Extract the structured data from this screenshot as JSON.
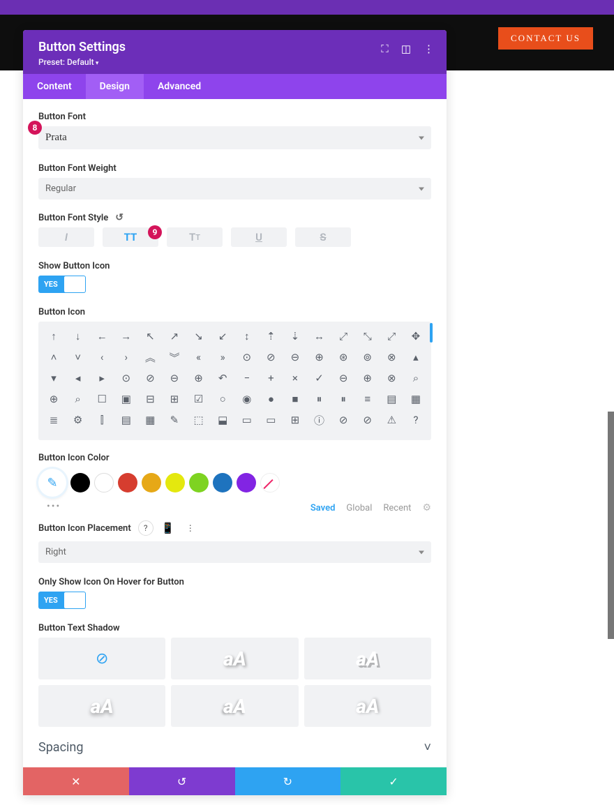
{
  "topbar": {
    "contact": "CONTACT US"
  },
  "panel": {
    "title": "Button Settings",
    "preset": "Preset: Default",
    "tabs": [
      "Content",
      "Design",
      "Advanced"
    ],
    "active_tab": 1
  },
  "badges": {
    "b8": "8",
    "b9": "9"
  },
  "sections": {
    "font": {
      "label": "Button Font",
      "value": "Prata"
    },
    "weight": {
      "label": "Button Font Weight",
      "value": "Regular"
    },
    "style": {
      "label": "Button Font Style"
    },
    "showicon": {
      "label": "Show Button Icon",
      "toggle": "YES"
    },
    "icon": {
      "label": "Button Icon"
    },
    "iconcolor": {
      "label": "Button Icon Color"
    },
    "colortabs": {
      "saved": "Saved",
      "global": "Global",
      "recent": "Recent"
    },
    "placement": {
      "label": "Button Icon Placement",
      "value": "Right"
    },
    "hover": {
      "label": "Only Show Icon On Hover for Button",
      "toggle": "YES"
    },
    "shadow": {
      "label": "Button Text Shadow"
    },
    "spacing": "Spacing"
  },
  "colors": [
    "#000000",
    "#ffffff",
    "#d63d2f",
    "#e6a817",
    "#e4e80e",
    "#7ed321",
    "#1e73be",
    "#8224e3"
  ],
  "shadow_text": "aA"
}
